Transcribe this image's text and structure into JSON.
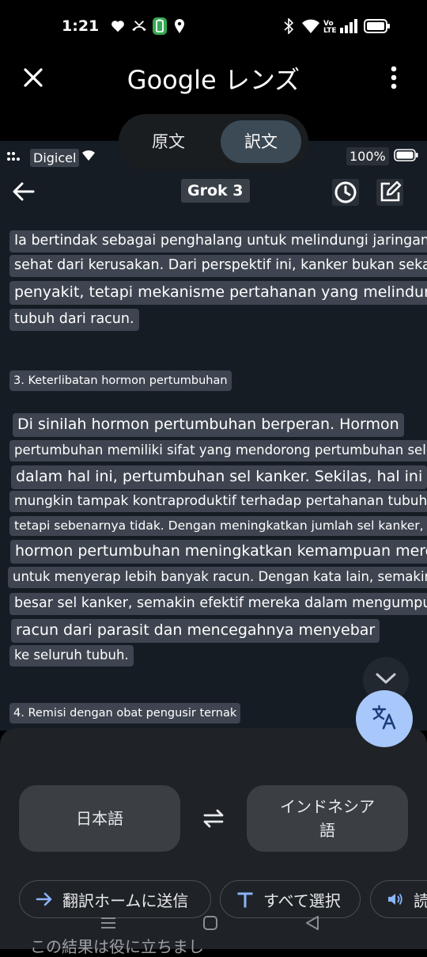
{
  "status_bar": {
    "time": "1:21",
    "network_label": "Vo LTE",
    "icons": [
      "heart-icon",
      "missed-call-icon",
      "battery-saver-icon",
      "location-icon",
      "bluetooth-icon",
      "wifi-icon",
      "signal-icon",
      "battery-icon"
    ]
  },
  "app_bar": {
    "title": "Google レンズ",
    "close_icon": "close-icon",
    "more_icon": "more-vert-icon"
  },
  "view_toggle": {
    "original": "原文",
    "translated": "訳文",
    "selected": "translated"
  },
  "inner_screen": {
    "carrier": "Digicel",
    "battery": "100%",
    "title": "Grok 3",
    "lines": [
      "Ia bertindak sebagai penghalang untuk melindungi jaringan",
      "sehat dari kerusakan. Dari perspektif ini, kanker bukan sekadar",
      "penyakit, tetapi mekanisme pertahanan yang melindungi",
      "tubuh dari racun.",
      "3. Keterlibatan hormon pertumbuhan",
      "Di sinilah hormon pertumbuhan berperan. Hormon",
      "pertumbuhan memiliki sifat yang mendorong pertumbuhan sel -",
      "dalam hal ini, pertumbuhan sel kanker. Sekilas, hal ini",
      "mungkin tampak kontraproduktif terhadap pertahanan tubuh,",
      "tetapi sebenarnya tidak. Dengan meningkatkan jumlah sel kanker,",
      "hormon pertumbuhan meningkatkan kemampuan mereka",
      "untuk menyerap lebih banyak racun. Dengan kata lain, semakin",
      "besar sel kanker, semakin efektif mereka dalam mengumpulkan",
      "racun dari parasit dan mencegahnya menyebar",
      "ke seluruh tubuh.",
      "4. Remisi dengan obat pengusir ternak"
    ]
  },
  "languages": {
    "source": "日本語",
    "target": "インドネシア語",
    "swap_icon": "swap-icon"
  },
  "actions": {
    "send": "翻訳ホームに送信",
    "select_all": "すべて選択",
    "listen": "読"
  },
  "peek_text": "この結果は役に立ちまし",
  "colors": {
    "fab": "#a8c7fa",
    "panel": "#161c24",
    "sheet": "#1f2226",
    "highlight": "#3e4550"
  }
}
